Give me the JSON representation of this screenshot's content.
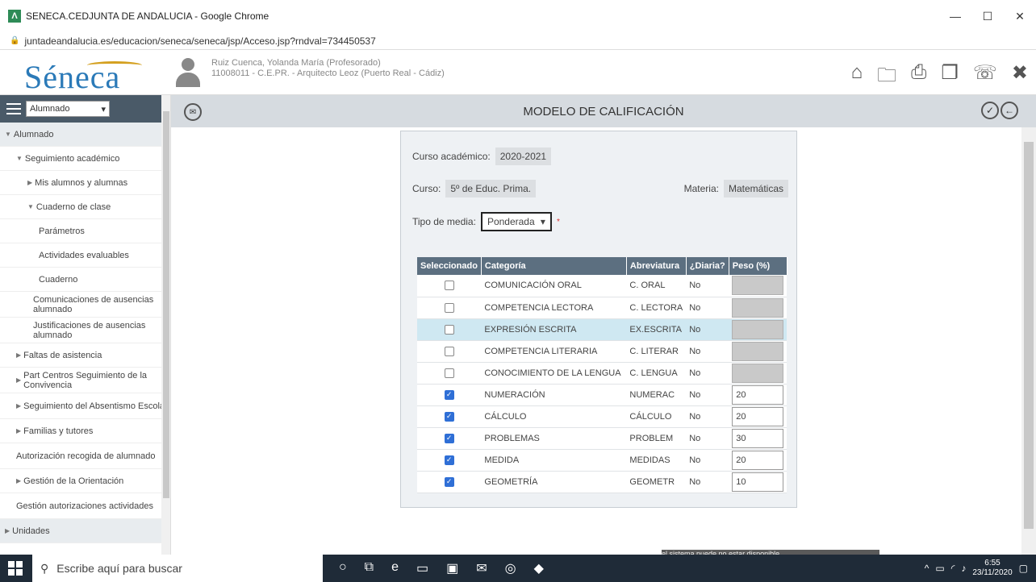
{
  "window": {
    "title": "SENECA.CEDJUNTA DE ANDALUCIA - Google Chrome",
    "url": "juntadeandalucia.es/educacion/seneca/seneca/jsp/Acceso.jsp?rndval=734450537"
  },
  "header": {
    "brand": "Séneca",
    "user_name": "Ruiz Cuenca, Yolanda María (Profesorado)",
    "user_center": "11008011 - C.E.PR. - Arquitecto Leoz (Puerto Real - Cádiz)"
  },
  "sidebar": {
    "selector": "Alumnado",
    "items": [
      {
        "label": "Alumnado",
        "indent": 0,
        "prefix": "▼",
        "active": true
      },
      {
        "label": "Seguimiento académico",
        "indent": 1,
        "prefix": "▼"
      },
      {
        "label": "Mis alumnos y alumnas",
        "indent": 2,
        "prefix": "▶"
      },
      {
        "label": "Cuaderno de clase",
        "indent": 2,
        "prefix": "▼"
      },
      {
        "label": "Parámetros",
        "indent": 3,
        "prefix": ""
      },
      {
        "label": "Actividades evaluables",
        "indent": 3,
        "prefix": ""
      },
      {
        "label": "Cuaderno",
        "indent": 3,
        "prefix": ""
      },
      {
        "label": "Comunicaciones de ausencias alumnado",
        "indent": 2.5,
        "prefix": ""
      },
      {
        "label": "Justificaciones de ausencias alumnado",
        "indent": 2.5,
        "prefix": ""
      },
      {
        "label": "Faltas de asistencia",
        "indent": 1,
        "prefix": "▶"
      },
      {
        "label": "Part Centros Seguimiento de la Convivencia",
        "indent": 1,
        "prefix": "▶"
      },
      {
        "label": "Seguimiento del Absentismo Escolar",
        "indent": 1,
        "prefix": "▶"
      },
      {
        "label": "Familias y tutores",
        "indent": 1,
        "prefix": "▶"
      },
      {
        "label": "Autorización recogida de alumnado",
        "indent": 1,
        "prefix": ""
      },
      {
        "label": "Gestión de la Orientación",
        "indent": 1,
        "prefix": "▶"
      },
      {
        "label": "Gestión autorizaciones actividades",
        "indent": 1,
        "prefix": ""
      },
      {
        "label": "Unidades",
        "indent": 0,
        "prefix": "▶",
        "active": true
      }
    ]
  },
  "main": {
    "title": "MODELO DE CALIFICACIÓN",
    "curso_academico_label": "Curso académico:",
    "curso_academico": "2020-2021",
    "curso_label": "Curso:",
    "curso": "5º de Educ. Prima.",
    "materia_label": "Materia:",
    "materia": "Matemáticas",
    "tipo_media_label": "Tipo de media:",
    "tipo_media": "Ponderada",
    "required_mark": "*",
    "columns": [
      "Seleccionado",
      "Categoría",
      "Abreviatura",
      "¿Diaria?",
      "Peso (%)"
    ],
    "rows": [
      {
        "selected": false,
        "categoria": "COMUNICACIÓN ORAL",
        "abrev": "C. ORAL",
        "diaria": "No",
        "peso": ""
      },
      {
        "selected": false,
        "categoria": "COMPETENCIA LECTORA",
        "abrev": "C. LECTORA",
        "diaria": "No",
        "peso": ""
      },
      {
        "selected": false,
        "categoria": "EXPRESIÓN ESCRITA",
        "abrev": "EX.ESCRITA",
        "diaria": "No",
        "peso": "",
        "highlight": true
      },
      {
        "selected": false,
        "categoria": "COMPETENCIA LITERARIA",
        "abrev": "C. LITERAR",
        "diaria": "No",
        "peso": ""
      },
      {
        "selected": false,
        "categoria": "CONOCIMIENTO DE LA LENGUA",
        "abrev": "C. LENGUA",
        "diaria": "No",
        "peso": ""
      },
      {
        "selected": true,
        "categoria": "NUMERACIÓN",
        "abrev": "NUMERAC",
        "diaria": "No",
        "peso": "20"
      },
      {
        "selected": true,
        "categoria": "CÁLCULO",
        "abrev": "CÁLCULO",
        "diaria": "No",
        "peso": "20"
      },
      {
        "selected": true,
        "categoria": "PROBLEMAS",
        "abrev": "PROBLEM",
        "diaria": "No",
        "peso": "30"
      },
      {
        "selected": true,
        "categoria": "MEDIDA",
        "abrev": "MEDIDAS",
        "diaria": "No",
        "peso": "20"
      },
      {
        "selected": true,
        "categoria": "GEOMETRÍA",
        "abrev": "GEOMETR",
        "diaria": "No",
        "peso": "10"
      }
    ],
    "notice": "el sistema puede no estar disponible."
  },
  "taskbar": {
    "search_placeholder": "Escribe aquí para buscar",
    "time": "6:55",
    "date": "23/11/2020"
  }
}
